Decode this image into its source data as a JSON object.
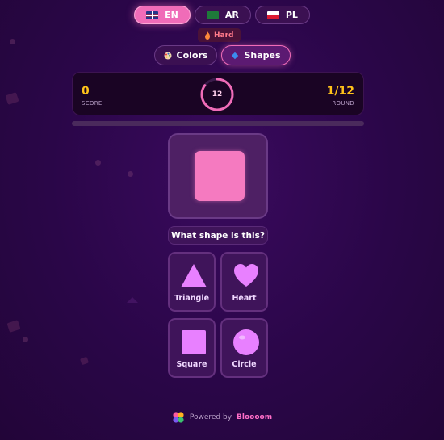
{
  "languages": [
    {
      "code": "EN",
      "flag": "flag-uk",
      "active": true
    },
    {
      "code": "AR",
      "flag": "flag-sa",
      "active": false
    },
    {
      "code": "PL",
      "flag": "flag-pl",
      "active": false
    }
  ],
  "difficulty": {
    "icon": "fire-icon",
    "label": "Hard",
    "color": "#ff7a8a"
  },
  "modes": [
    {
      "icon": "palette-icon",
      "label": "Colors",
      "active": false
    },
    {
      "icon": "diamond-icon",
      "label": "Shapes",
      "active": true
    }
  ],
  "scoreboard": {
    "score_value": "0",
    "score_label": "SCORE",
    "timer_value": "12",
    "timer_fraction": 0.85,
    "round_value": "1/12",
    "round_label": "ROUND"
  },
  "progress": {
    "fraction": 0.0
  },
  "target": {
    "shape": "square",
    "color": "#f57ac0"
  },
  "question": "What shape is this?",
  "options": [
    {
      "label": "Triangle",
      "icon": "triangle-icon"
    },
    {
      "label": "Heart",
      "icon": "heart-icon"
    },
    {
      "label": "Square",
      "icon": "square-icon"
    },
    {
      "label": "Circle",
      "icon": "circle-icon"
    }
  ],
  "footer": {
    "prefix": "Powered by",
    "brand": "Bloooom"
  },
  "colors": {
    "accent": "#f06cb8",
    "gold": "#ffc21a",
    "option_fill": "#e880ff"
  }
}
